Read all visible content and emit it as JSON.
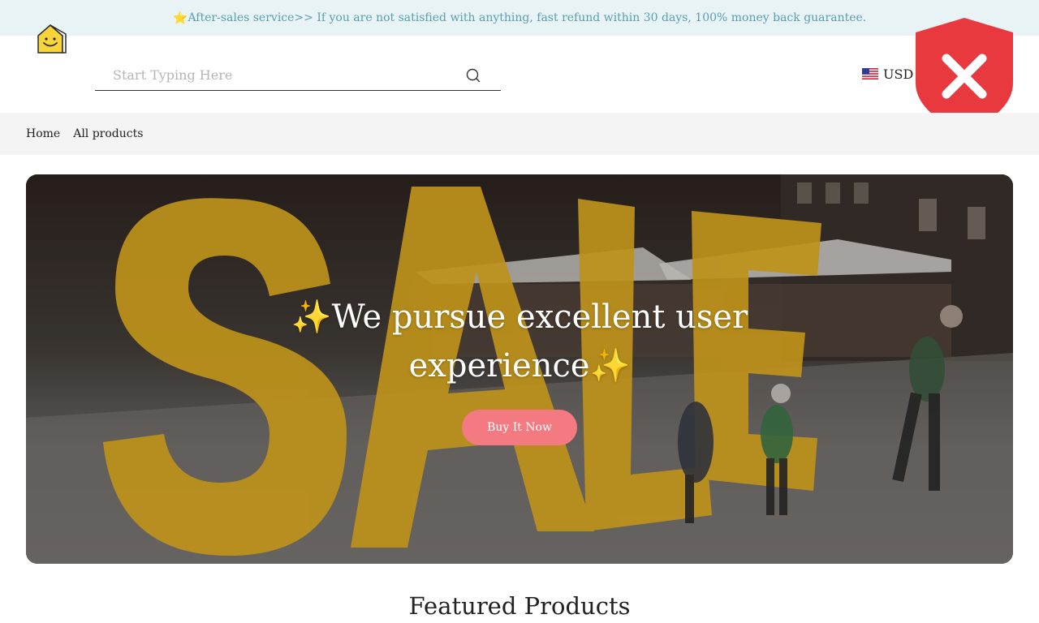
{
  "announcement": {
    "star_icon": "star-icon",
    "text": "After-sales service>> If you are not satisfied with anything, fast refund within 30 days, 100% money back guarantee."
  },
  "header": {
    "logo_icon": "smiley-house-logo",
    "search": {
      "placeholder": "Start Typing Here",
      "value": "",
      "button_icon": "search-icon"
    },
    "currency": {
      "flag_icon": "us-flag-icon",
      "label": "USD"
    }
  },
  "overlay": {
    "icon": "shield-x-icon",
    "color": "#e8393f"
  },
  "nav": {
    "items": [
      {
        "label": "Home"
      },
      {
        "label": "All products"
      }
    ]
  },
  "hero": {
    "heading": "✨We pursue excellent user experience✨",
    "button_label": "Buy It Now",
    "button_color": "#f37a80",
    "background_word": "SALE"
  },
  "featured": {
    "title": "Featured Products"
  },
  "colors": {
    "announcement_bg": "#e8f3f5",
    "announcement_text": "#5a9fb0",
    "nav_bg": "#f3f4f3",
    "sale_yellow": "#e8b321"
  }
}
